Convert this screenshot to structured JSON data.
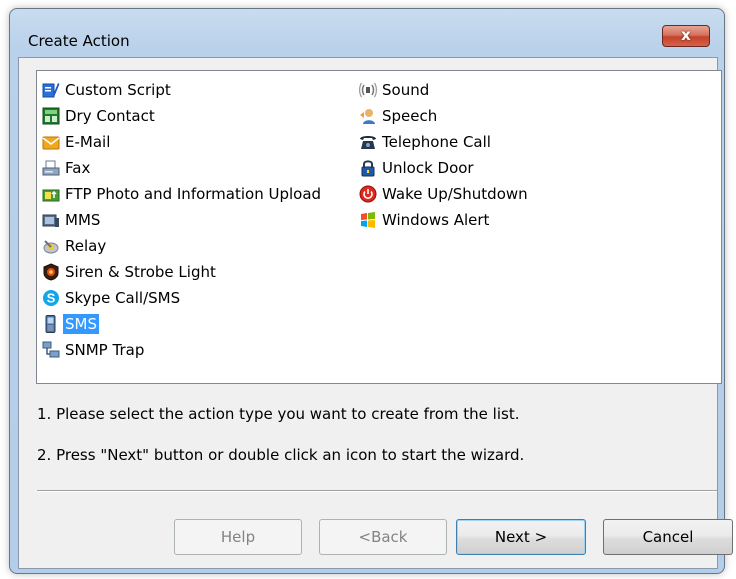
{
  "window": {
    "title": "Create Action",
    "close_label": "x"
  },
  "list": {
    "column1": [
      {
        "label": "Custom Script",
        "icon": "script-icon"
      },
      {
        "label": "Dry Contact",
        "icon": "dry-contact-icon"
      },
      {
        "label": "E-Mail",
        "icon": "email-icon"
      },
      {
        "label": "Fax",
        "icon": "fax-icon"
      },
      {
        "label": "FTP Photo and Information Upload",
        "icon": "ftp-upload-icon"
      },
      {
        "label": "MMS",
        "icon": "mms-icon"
      },
      {
        "label": "Relay",
        "icon": "relay-icon"
      },
      {
        "label": "Siren & Strobe Light",
        "icon": "siren-icon"
      },
      {
        "label": "Skype Call/SMS",
        "icon": "skype-icon"
      },
      {
        "label": "SMS",
        "icon": "sms-phone-icon",
        "selected": true
      },
      {
        "label": "SNMP Trap",
        "icon": "snmp-network-icon"
      }
    ],
    "column2": [
      {
        "label": "Sound",
        "icon": "sound-icon"
      },
      {
        "label": "Speech",
        "icon": "speech-icon"
      },
      {
        "label": "Telephone Call",
        "icon": "telephone-icon"
      },
      {
        "label": "Unlock Door",
        "icon": "padlock-icon"
      },
      {
        "label": "Wake Up/Shutdown",
        "icon": "power-icon"
      },
      {
        "label": "Windows Alert",
        "icon": "windows-flag-icon"
      }
    ]
  },
  "instructions": {
    "step1": "1. Please select the action type you want to create from the list.",
    "step2": "2. Press \"Next\" button or double click an icon to start the wizard."
  },
  "buttons": {
    "help": "Help",
    "back": "<Back",
    "next": "Next >",
    "cancel": "Cancel"
  },
  "colors": {
    "selection": "#3399ff",
    "title_bar": "#b9d1ea",
    "close_button": "#c4432a"
  }
}
